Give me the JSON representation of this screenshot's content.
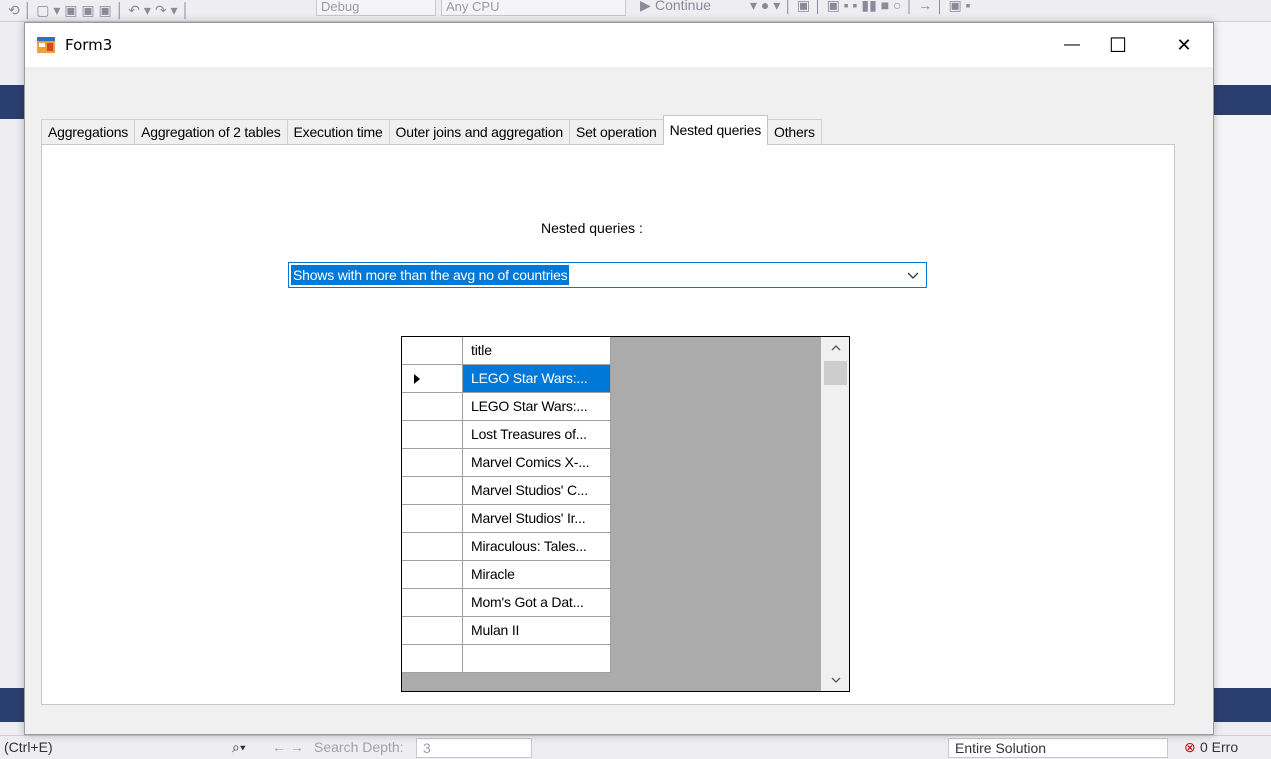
{
  "vs": {
    "toolbar_debug": "Debug",
    "toolbar_cpu": "Any CPU",
    "toolbar_continue": "Continue",
    "status_shortcut": "(Ctrl+E)",
    "status_search_depth": "Search Depth:",
    "status_search_depth_value": "3",
    "status_scope": "Entire Solution",
    "status_errors": "0 Erro"
  },
  "window": {
    "title": "Form3",
    "minimize_glyph": "—",
    "maximize_glyph": "☐",
    "close_glyph": "✕"
  },
  "tabs": [
    {
      "label": "Aggregations",
      "active": false
    },
    {
      "label": "Aggregation of 2 tables",
      "active": false
    },
    {
      "label": "Execution time",
      "active": false
    },
    {
      "label": "Outer joins and aggregation",
      "active": false
    },
    {
      "label": "Set operation",
      "active": false
    },
    {
      "label": "Nested queries",
      "active": true
    },
    {
      "label": "Others",
      "active": false
    }
  ],
  "nested": {
    "label": "Nested queries :",
    "selected_query": "Shows with more than the avg no of countries"
  },
  "grid": {
    "header": "title",
    "rows": [
      "LEGO Star Wars:...",
      "LEGO Star Wars:...",
      "Lost Treasures of...",
      "Marvel Comics X-...",
      "Marvel Studios' C...",
      "Marvel Studios' Ir...",
      "Miraculous: Tales...",
      "Miracle",
      "Mom's Got a Dat...",
      "Mulan II"
    ],
    "selected_row": 0
  },
  "colors": {
    "accent": "#0078d7",
    "grid_background": "#ababab",
    "vs_band": "#2b3e70"
  }
}
